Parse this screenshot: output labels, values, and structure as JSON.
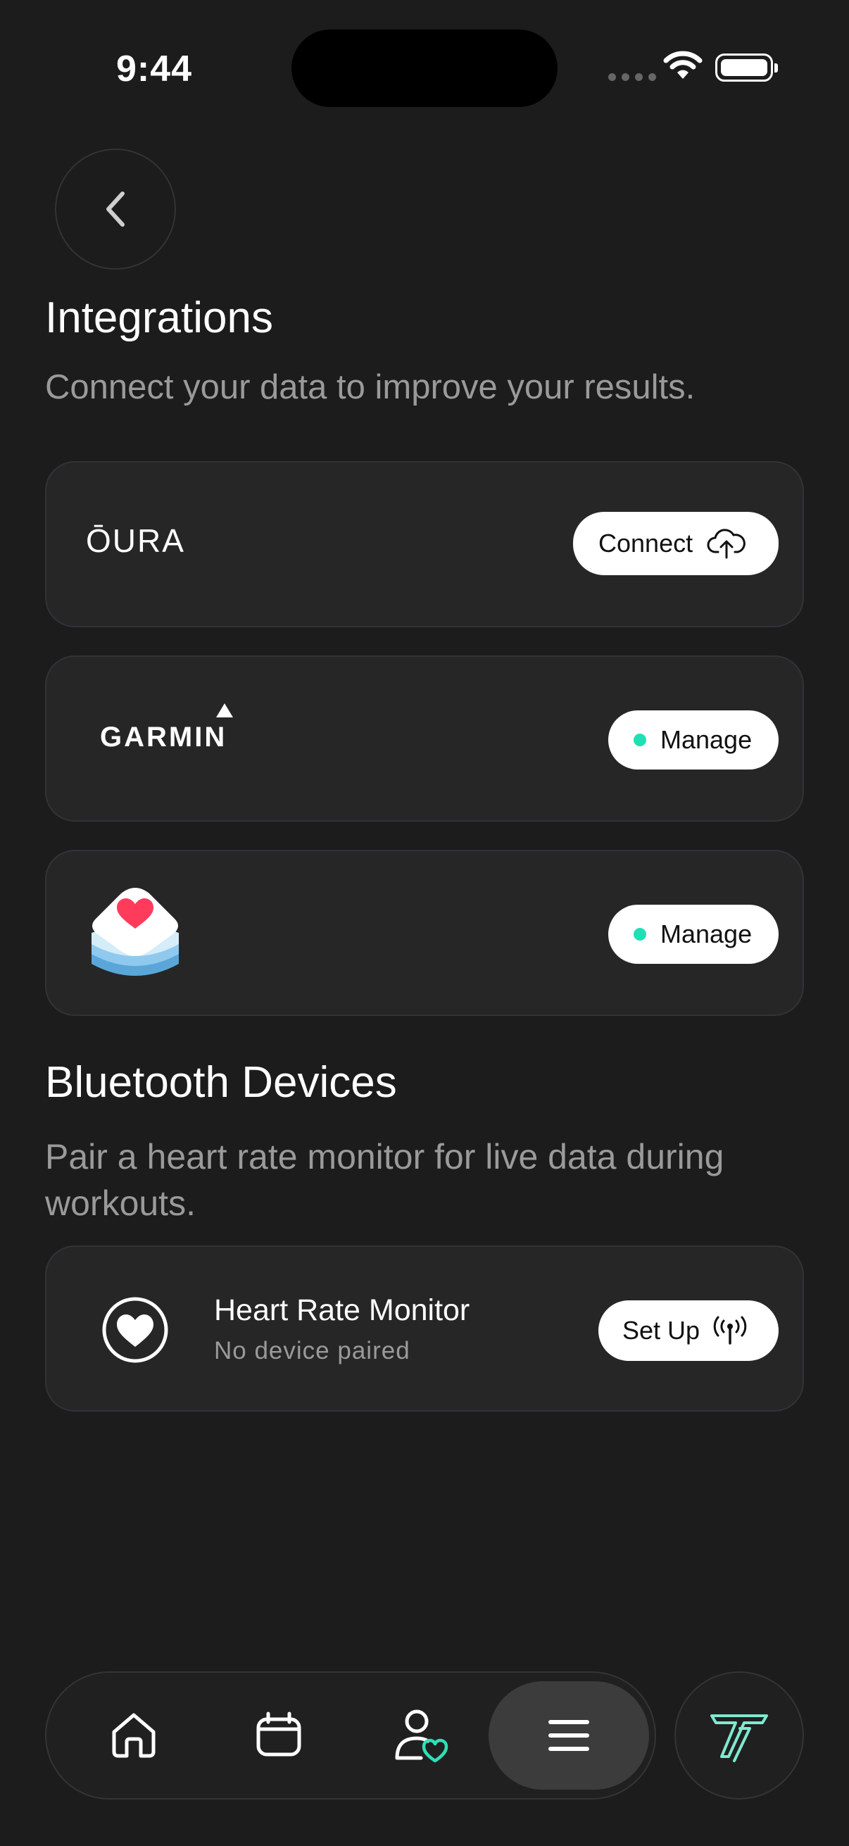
{
  "status": {
    "time": "9:44"
  },
  "header": {
    "title": "Integrations",
    "subtitle": "Connect your data to improve your results."
  },
  "integrations": [
    {
      "brand": "ŌURA",
      "button": "Connect",
      "button_icon": "cloud-upload-icon",
      "connected": false
    },
    {
      "brand": "GARMIN",
      "button": "Manage",
      "connected": true
    },
    {
      "brand_icon": "apple-health-icon",
      "button": "Manage",
      "connected": true
    }
  ],
  "bluetooth": {
    "title": "Bluetooth Devices",
    "subtitle": "Pair a heart rate monitor for live data during workouts.",
    "device": {
      "name": "Heart Rate Monitor",
      "status": "No device paired",
      "button": "Set Up",
      "button_icon": "antenna-icon"
    }
  },
  "nav": {
    "items": [
      "home-icon",
      "calendar-icon",
      "profile-heart-icon",
      "menu-icon"
    ],
    "active": "menu-icon",
    "app_logo": "app-logo-icon"
  },
  "colors": {
    "background": "#1c1c1d",
    "card": "#262627",
    "status_dot": "#1fe0b4"
  }
}
